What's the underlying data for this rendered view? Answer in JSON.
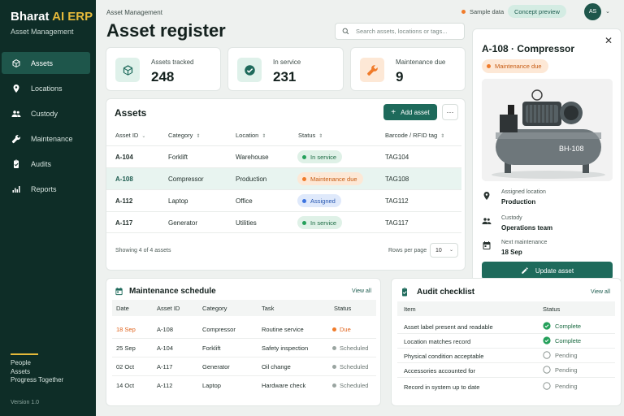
{
  "app": {
    "brand_main": "Bharat ",
    "brand_ai": "AI ERP",
    "brand_sub": "Asset Management",
    "tagline": [
      "People",
      "Assets",
      "Progress Together"
    ],
    "version": "Version 1.0"
  },
  "sidebar": {
    "items": [
      {
        "label": "Assets",
        "icon": "cube-icon",
        "active": true
      },
      {
        "label": "Locations",
        "icon": "location-pin-icon",
        "active": false
      },
      {
        "label": "Custody",
        "icon": "people-icon",
        "active": false
      },
      {
        "label": "Maintenance",
        "icon": "wrench-icon",
        "active": false
      },
      {
        "label": "Audits",
        "icon": "clipboard-check-icon",
        "active": false
      },
      {
        "label": "Reports",
        "icon": "bar-chart-icon",
        "active": false
      }
    ]
  },
  "header": {
    "breadcrumb": "Asset Management",
    "title": "Asset register",
    "sample_label": "Sample data",
    "concept_label": "Concept preview",
    "avatar_initials": "AS",
    "search_placeholder": "Search assets, locations or tags..."
  },
  "stats": [
    {
      "label": "Assets tracked",
      "value": "248",
      "icon": "cube-icon",
      "color": "#1e6a5b"
    },
    {
      "label": "In service",
      "value": "231",
      "icon": "check-circle-icon",
      "color": "#1e6a5b"
    },
    {
      "label": "Maintenance due",
      "value": "9",
      "icon": "wrench-icon",
      "color": "#f07b2a"
    }
  ],
  "assets": {
    "title": "Assets",
    "add_label": "Add asset",
    "more_label": "···",
    "columns": [
      "Asset ID",
      "Category",
      "Location",
      "Status",
      "Barcode / RFID tag"
    ],
    "rows": [
      {
        "id": "A-104",
        "category": "Forklift",
        "location": "Warehouse",
        "status": "In service",
        "tag": "TAG104"
      },
      {
        "id": "A-108",
        "category": "Compressor",
        "location": "Production",
        "status": "Maintenance due",
        "tag": "TAG108"
      },
      {
        "id": "A-112",
        "category": "Laptop",
        "location": "Office",
        "status": "Assigned",
        "tag": "TAG112"
      },
      {
        "id": "A-117",
        "category": "Generator",
        "location": "Utilities",
        "status": "In service",
        "tag": "TAG117"
      }
    ],
    "showing": "Showing 4 of 4 assets",
    "rows_per_page_label": "Rows per page",
    "rows_per_page_value": "10"
  },
  "detail": {
    "title": "A-108 · Compressor",
    "status": "Maintenance due",
    "photo_label": "BH-108",
    "assigned_location_label": "Assigned location",
    "assigned_location_value": "Production",
    "custody_label": "Custody",
    "custody_value": "Operations team",
    "next_maintenance_label": "Next maintenance",
    "next_maintenance_value": "18 Sep",
    "update_label": "Update asset"
  },
  "maintenance": {
    "title": "Maintenance schedule",
    "view_all": "View all",
    "columns": [
      "Date",
      "Asset ID",
      "Category",
      "Task",
      "Status"
    ],
    "rows": [
      {
        "date": "18 Sep",
        "id": "A-108",
        "category": "Compressor",
        "task": "Routine service",
        "status": "Due"
      },
      {
        "date": "25 Sep",
        "id": "A-104",
        "category": "Forklift",
        "task": "Safety inspection",
        "status": "Scheduled"
      },
      {
        "date": "02 Oct",
        "id": "A-117",
        "category": "Generator",
        "task": "Oil change",
        "status": "Scheduled"
      },
      {
        "date": "14 Oct",
        "id": "A-112",
        "category": "Laptop",
        "task": "Hardware check",
        "status": "Scheduled"
      }
    ]
  },
  "audit": {
    "title": "Audit checklist",
    "view_all": "View all",
    "columns": [
      "Item",
      "Status"
    ],
    "rows": [
      {
        "item": "Asset label present and readable",
        "status": "Complete"
      },
      {
        "item": "Location matches record",
        "status": "Complete"
      },
      {
        "item": "Physical condition acceptable",
        "status": "Pending"
      },
      {
        "item": "Accessories accounted for",
        "status": "Pending"
      },
      {
        "item": "Record in system up to date",
        "status": "Pending"
      }
    ]
  },
  "colors": {
    "sidebar": "#0e2d27",
    "accent": "#1e6a5b",
    "warning": "#f07b2a",
    "success": "#24a05a",
    "info": "#3c74e0"
  }
}
